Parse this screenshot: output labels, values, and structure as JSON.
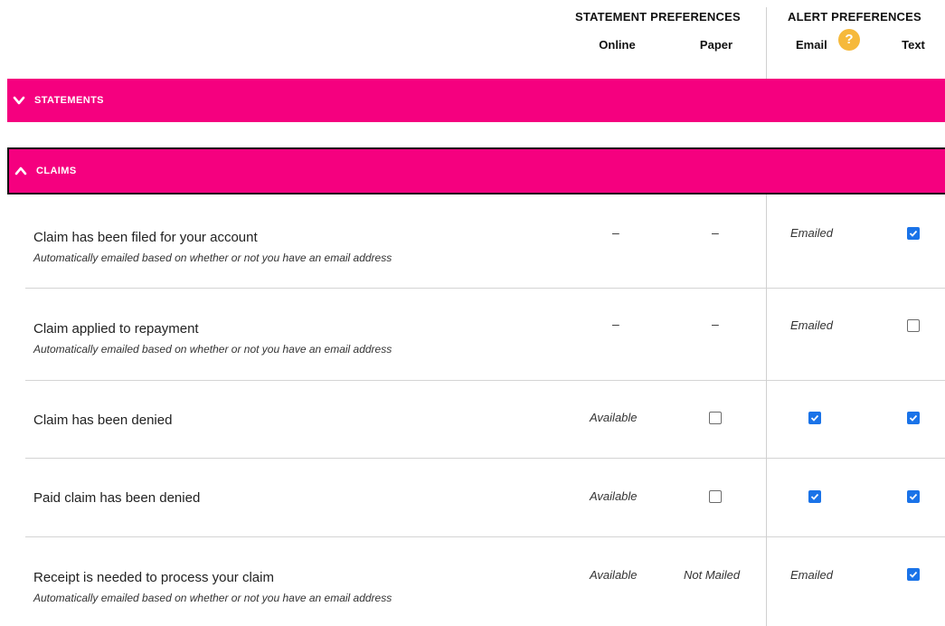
{
  "header": {
    "statement_group": "STATEMENT PREFERENCES",
    "alert_group": "ALERT PREFERENCES",
    "columns": {
      "online": "Online",
      "paper": "Paper",
      "email": "Email",
      "text": "Text"
    },
    "help_glyph": "?"
  },
  "sections": {
    "statements": {
      "label": "STATEMENTS",
      "expanded": false
    },
    "claims": {
      "label": "CLAIMS",
      "expanded": true
    }
  },
  "rows": [
    {
      "title": "Claim has been filed for your account",
      "subtitle": "Automatically emailed based on whether or not you have an email address",
      "online": "–",
      "paper": "–",
      "email": "Emailed",
      "text_checked": true
    },
    {
      "title": "Claim applied to repayment",
      "subtitle": "Automatically emailed based on whether or not you have an email address",
      "online": "–",
      "paper": "–",
      "email": "Emailed",
      "text_checked": false
    },
    {
      "title": "Claim has been denied",
      "subtitle": "",
      "online": "Available",
      "paper_checked": false,
      "email_checked": true,
      "text_checked": true
    },
    {
      "title": "Paid claim has been denied",
      "subtitle": "",
      "online": "Available",
      "paper_checked": false,
      "email_checked": true,
      "text_checked": true
    },
    {
      "title": "Receipt is needed to process your claim",
      "subtitle": "Automatically emailed based on whether or not you have an email address",
      "online": "Available",
      "paper": "Not Mailed",
      "email": "Emailed",
      "text_checked": true
    }
  ],
  "colors": {
    "accent": "#f5007f",
    "checkbox": "#1a73e8",
    "help": "#f6b93b"
  },
  "icons": {
    "statements_chevron": "chevron-down-icon",
    "claims_chevron": "chevron-up-icon",
    "help": "help-icon"
  }
}
